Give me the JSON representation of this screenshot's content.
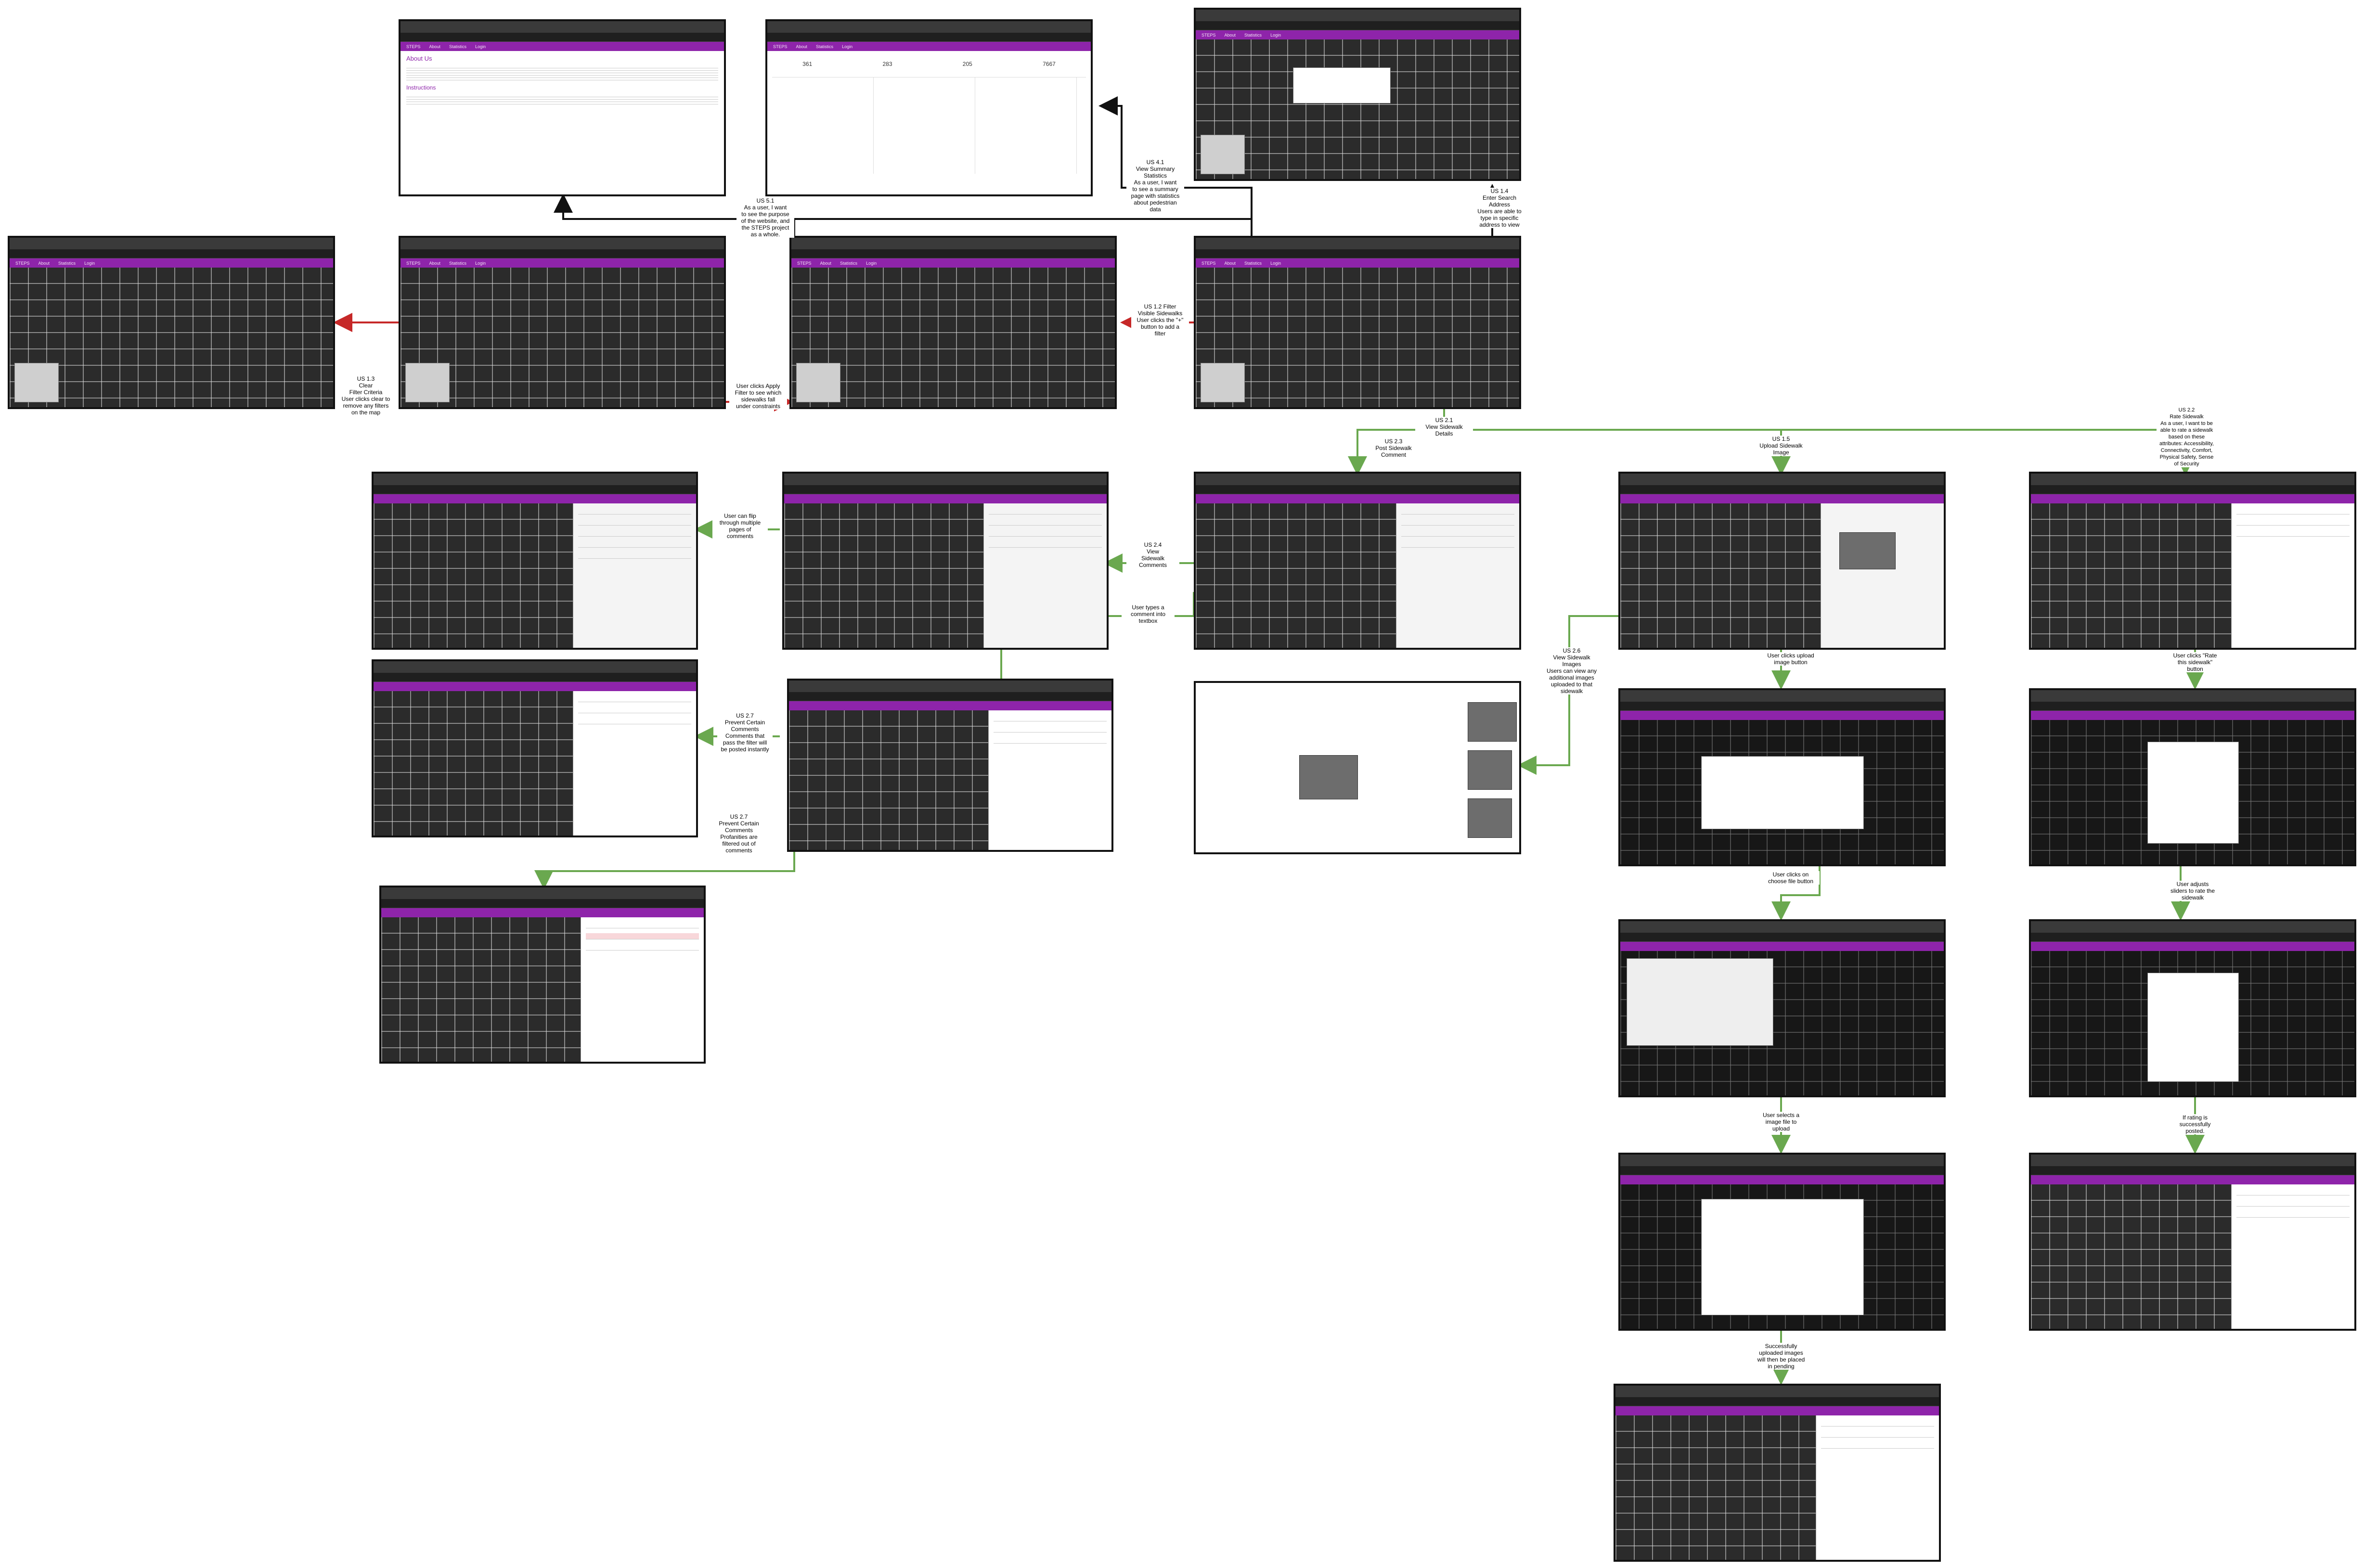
{
  "header_nav": [
    "STEPS",
    "About",
    "Statistics",
    "Login"
  ],
  "screens": {
    "about": {
      "heading": "About Us",
      "subheading": "Instructions"
    },
    "stats": {
      "values": [
        "361",
        "283",
        "205",
        "7667"
      ]
    }
  },
  "labels": {
    "us41": "US 4.1\nView Summary\nStatistics\nAs a user, I want\nto see a summary\npage with statistics\nabout pedestrian\ndata",
    "us51": "US 5.1\nAs a user, I want\nto see the purpose\nof the website, and\nthe STEPS project\nas a whole.",
    "us14": "US 1.4\nEnter Search\nAddress\nUsers are able to\ntype in specific\naddress to view",
    "us12": "US 1.2  Filter\nVisible Sidewalks\nUser clicks the \"+\"\nbutton to add a\nfilter",
    "us13": "US 1.3\nClear\nFilter Criteria\nUser clicks clear to\nremove any filters\non the map",
    "apply": "User clicks Apply\nFilter to see which\nsidewalks fall\nunder constraints",
    "us21": "US 2.1\nView Sidewalk\nDetails",
    "us23": "US 2.3\nPost Sidewalk\nComment",
    "us15": "US 1.5\nUpload Sidewalk\nImage",
    "us22": "US 2.2\nRate Sidewalk\nAs a user, I want to be\nable to rate a sidewalk\nbased on these\nattributes: Accessibility,\nConnectivity, Comfort,\nPhysical Safety, Sense\nof Security",
    "us24": "US 2.4\nView\nSidewalk\nComments",
    "flip": "User can flip\nthrough multiple\npages of\ncomments",
    "types": "User types a\ncomment into\ntextbox",
    "us26": "US 2.6\nView Sidewalk\nImages\nUsers can view any\nadditional images\nuploaded to that\nsidewalk",
    "us27a": "US 2.7\nPrevent Certain\nComments\nComments that\npass the filter will\nbe posted instantly",
    "us27b": "US 2.7\nPrevent Certain\nComments\nProfanities are\nfiltered out  of\ncomments",
    "upload_btn": "User clicks upload\nimage button",
    "choose_btn": "User clicks on\nchoose file button",
    "select_img": "User selects a\nimage file to\nupload",
    "pending": "Successfully\nuploaded images\nwill then be placed\nin pending",
    "rate_btn": "User clicks \"Rate\nthis sidewalk\"\nbutton",
    "sliders": "User adjusts\nsliders to rate the\nsidewalk",
    "posted": "If rating is\nsuccessfully\nposted."
  },
  "colors": {
    "nav": "#8e24aa",
    "arrow_black": "#111111",
    "arrow_red": "#c62828",
    "arrow_green": "#6aa84f"
  }
}
